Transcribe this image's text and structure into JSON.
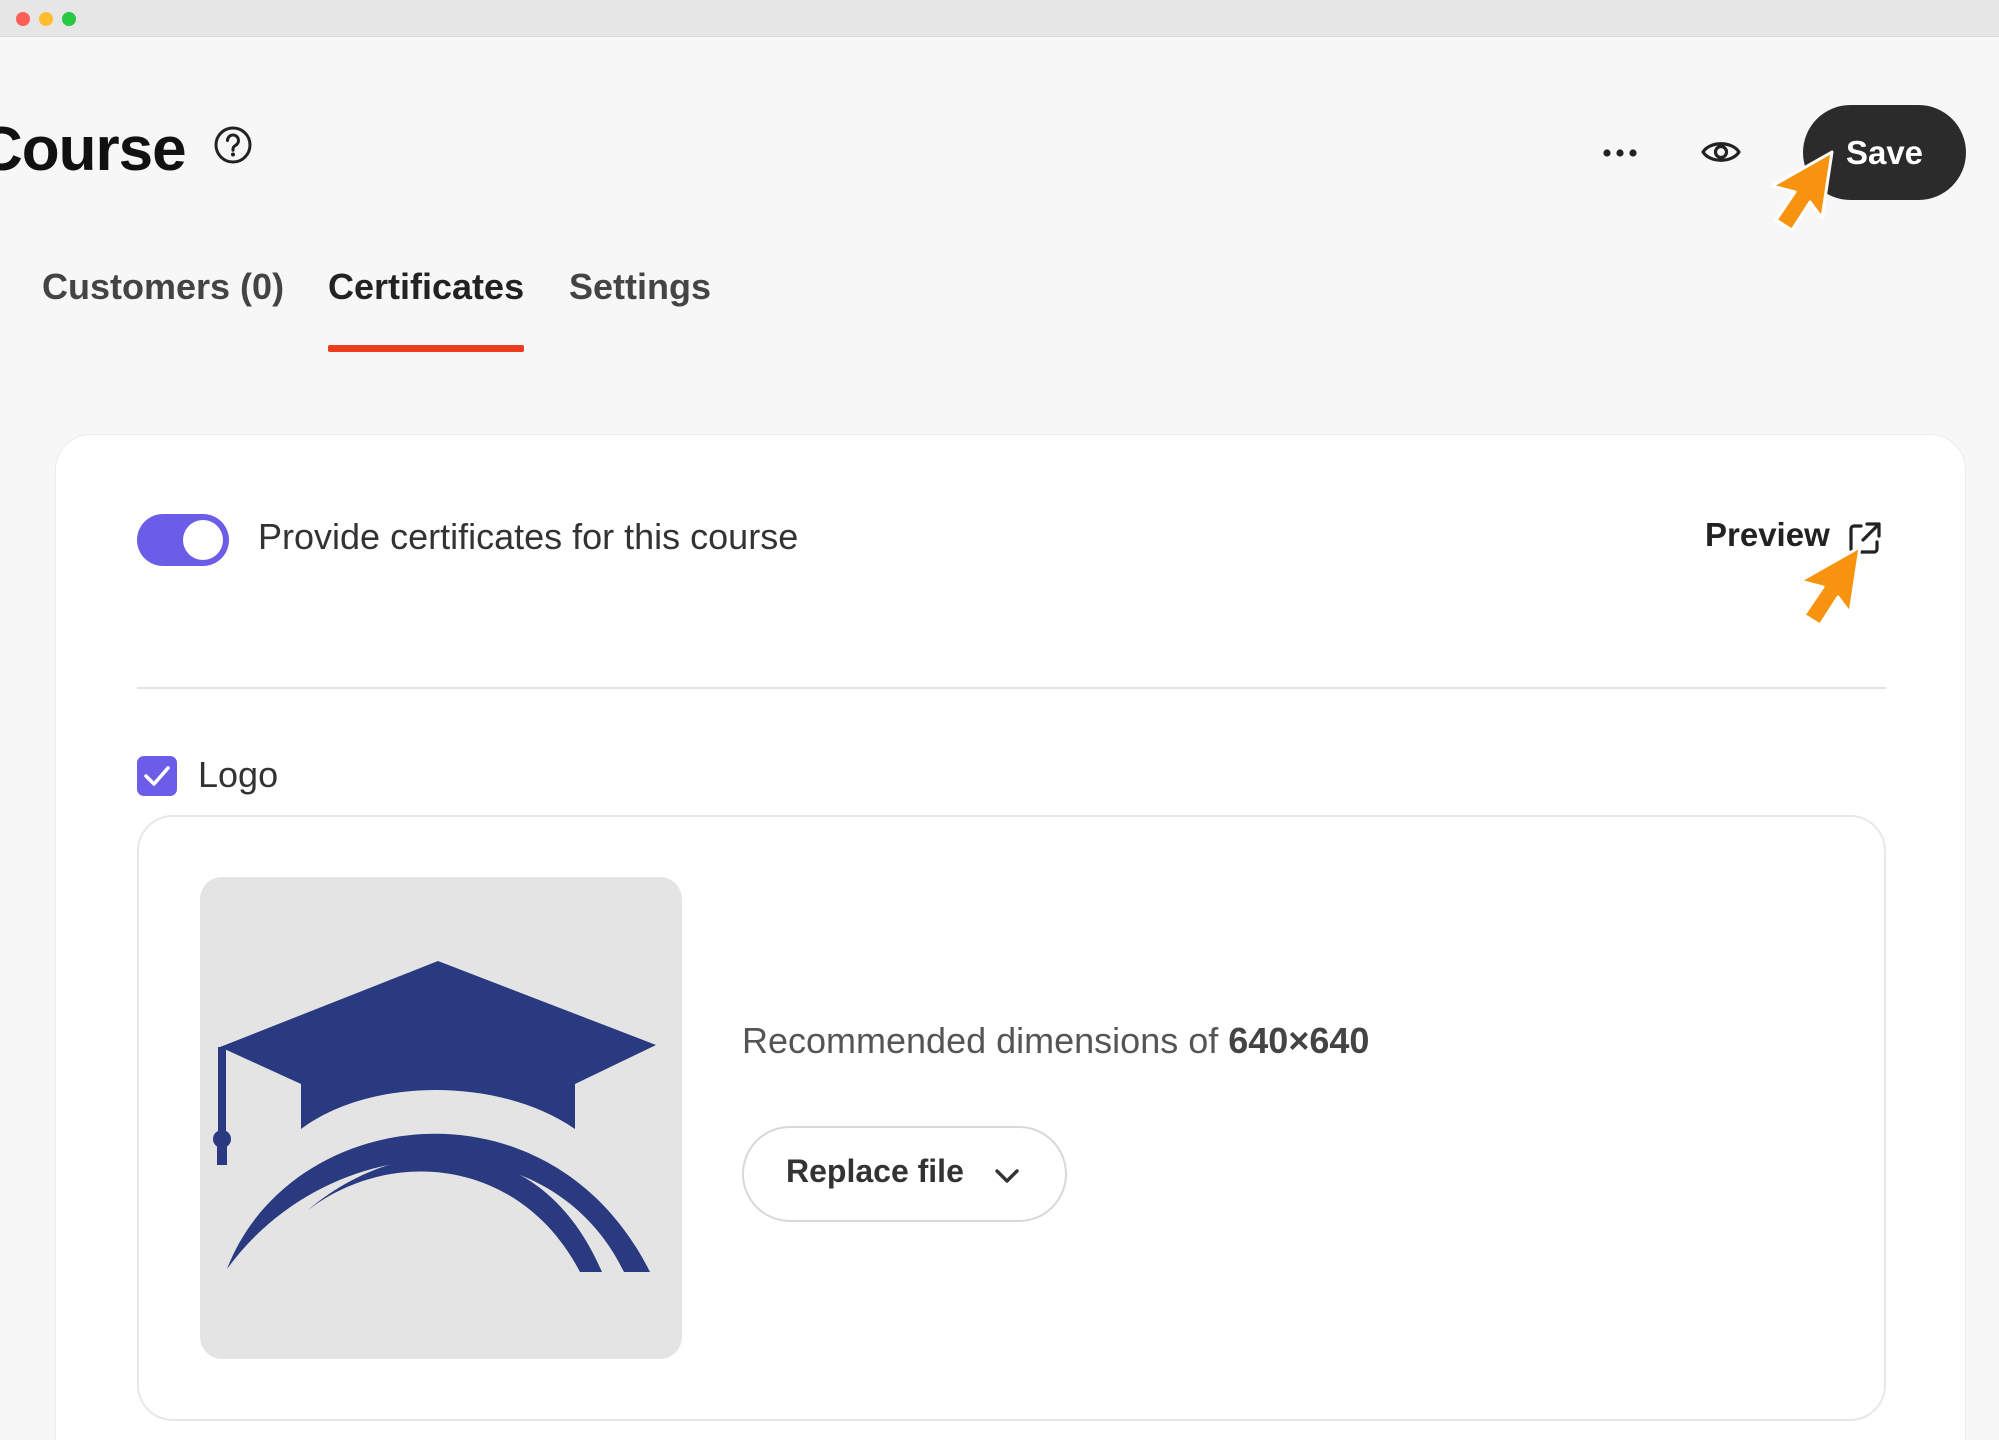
{
  "window": {
    "controls": [
      "close",
      "minimize",
      "maximize"
    ]
  },
  "header": {
    "title": "Course",
    "help_icon": "question-circle-icon",
    "more_icon": "ellipsis-icon",
    "preview_icon": "eye-icon",
    "save_label": "Save"
  },
  "tabs": [
    {
      "label": "Customers (0)",
      "active": false
    },
    {
      "label": "Certificates",
      "active": true
    },
    {
      "label": "Settings",
      "active": false
    }
  ],
  "certificates": {
    "toggle_label": "Provide certificates for this course",
    "toggle_on": true,
    "preview_label": "Preview",
    "preview_icon": "external-link-icon",
    "logo": {
      "checkbox_label": "Logo",
      "checked": true,
      "thumbnail_icon": "graduation-cap-icon",
      "dimensions_prefix": "Recommended dimensions of ",
      "dimensions_value": "640×640",
      "replace_label": "Replace file",
      "replace_icon": "chevron-down-icon"
    }
  },
  "colors": {
    "accent": "#6b5de7",
    "tab_underline": "#ec3c1e",
    "save_bg": "#2b2b2b",
    "cursor": "#f7930e",
    "logo_navy": "#2a3a80"
  }
}
